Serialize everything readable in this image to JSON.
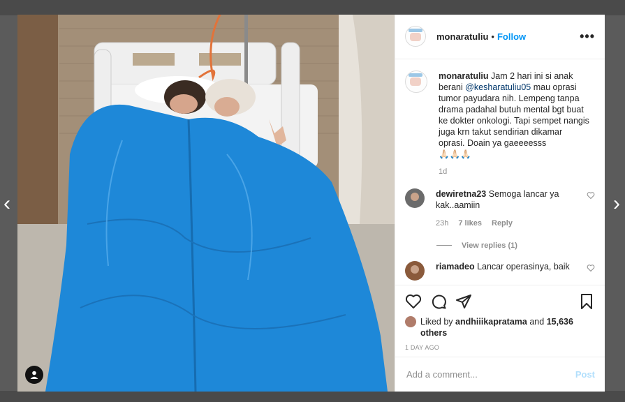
{
  "navigation": {
    "prev_icon": "chevron-left-icon",
    "next_icon": "chevron-right-icon",
    "prev_glyph": "‹",
    "next_glyph": "›"
  },
  "post": {
    "username": "monaratuliu",
    "separator": "•",
    "follow_label": "Follow",
    "more_label": "•••",
    "caption_prefix": "Jam 2 hari ini si anak berani",
    "caption_mention": "@kesharatuliu05",
    "caption_suffix": "mau oprasi tumor payudara nih. Lempeng tanpa drama padahal butuh mental bgt buat ke dokter onkologi. Tapi sempet nangis juga krn takut sendirian dikamar oprasi. Doain ya gaeeeesss",
    "caption_emoji": "🙏🏻🙏🏻🙏🏻",
    "caption_time": "1d"
  },
  "comments": [
    {
      "username": "dewiretna23",
      "text": "Semoga lancar ya kak..aamiin",
      "time": "23h",
      "likes": "7 likes",
      "reply_label": "Reply"
    },
    {
      "username": "riamadeo",
      "text": "Lancar operasinya, baik"
    }
  ],
  "view_replies_label": "View replies (1)",
  "likes_line": {
    "prefix": "Liked by",
    "user": "andhiiikapratama",
    "conjunction": "and",
    "count": "15,636 others"
  },
  "post_time": "1 DAY AGO",
  "add_comment": {
    "placeholder": "Add a comment...",
    "post_label": "Post"
  },
  "colors": {
    "accent": "#0095f6",
    "post_disabled": "#b2dffc",
    "blanket": "#1e88d8",
    "muted": "#8e8e8e"
  }
}
